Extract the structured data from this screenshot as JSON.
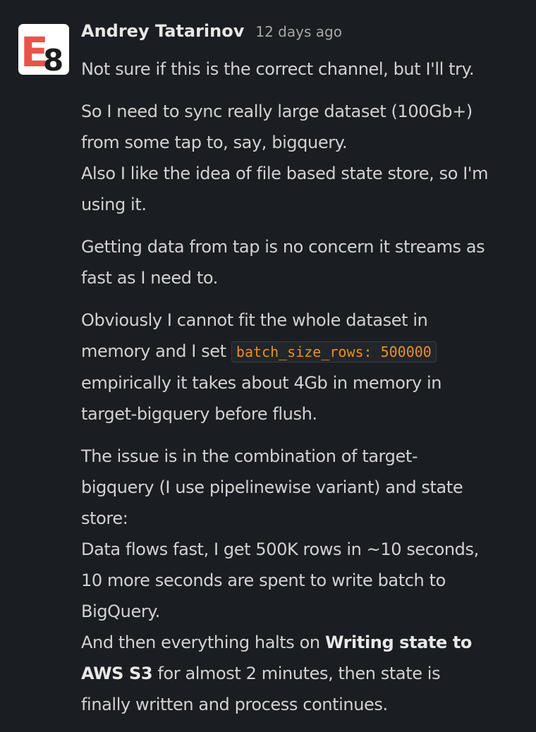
{
  "message": {
    "author": "Andrey Tatarinov",
    "timestamp": "12 days ago",
    "avatar": {
      "text_e": "E",
      "text_8": "8",
      "color_e": "#e8534a",
      "color_8": "#1d1c1d"
    },
    "p1": {
      "l1": "Not sure if this is the correct channel, but I'll try."
    },
    "p2": {
      "l1": "So I need to sync really large dataset (100Gb+)",
      "l2": "from some tap to, say, bigquery.",
      "l3": "Also I like the idea of file based state store, so I'm",
      "l4": "using it."
    },
    "p3": {
      "l1": "Getting data from tap is no concern it streams as",
      "l2": "fast as I need to."
    },
    "p4": {
      "l1": "Obviously I cannot fit the whole dataset in",
      "l2_pre": "memory and I set ",
      "l2_code": "batch_size_rows: 500000",
      "l3": "empirically it takes about 4Gb in memory in",
      "l4": "target-bigquery before flush."
    },
    "p5": {
      "l1": "The issue is in the combination of target-",
      "l2": "bigquery (I use pipelinewise variant) and state",
      "l3": "store:",
      "l4": "Data flows fast, I get 500K rows in ~10 seconds,",
      "l5": "10 more seconds are spent to write batch to",
      "l6": "BigQuery.",
      "l7_pre": "And then everything halts on ",
      "l7_bold": "Writing state to",
      "l8_bold": "AWS S3",
      "l8_post": " for almost 2 minutes, then state is",
      "l9": "finally written and process continues."
    }
  }
}
